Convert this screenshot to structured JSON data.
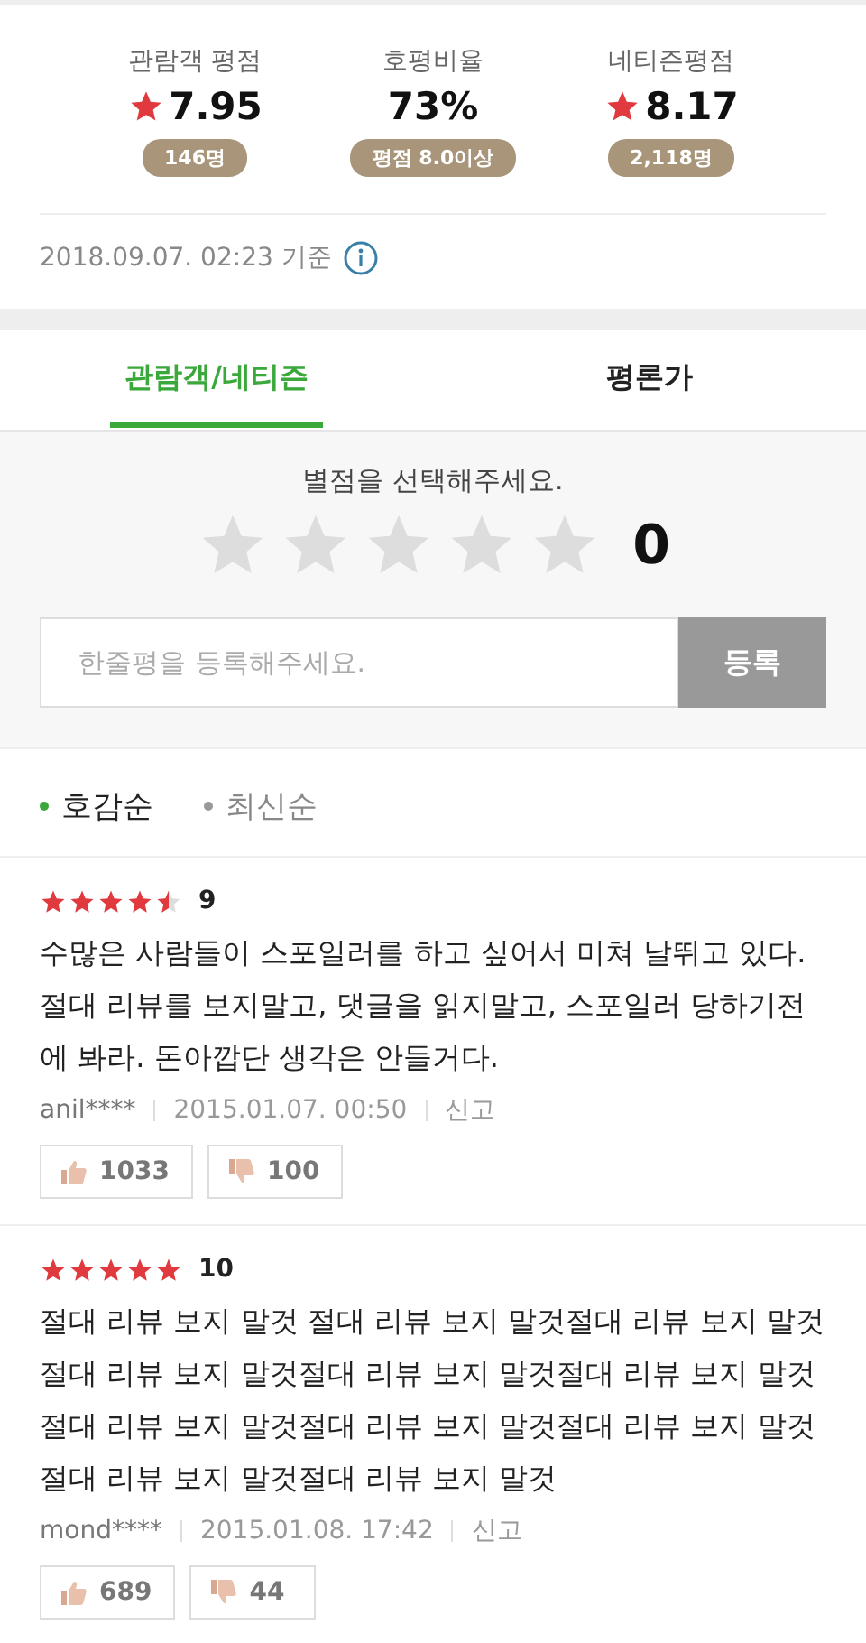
{
  "scores": [
    {
      "kind": "star",
      "label": "관람객 평점",
      "value": "7.95",
      "badge": "146명"
    },
    {
      "kind": "plain",
      "label": "호평비율",
      "value": "73%",
      "badge": "평점 8.0이상"
    },
    {
      "kind": "star",
      "label": "네티즌평점",
      "value": "8.17",
      "badge": "2,118명"
    }
  ],
  "timestamp": "2018.09.07. 02:23 기준",
  "tabs": [
    {
      "label": "관람객/네티즌",
      "selected": true
    },
    {
      "label": "평론가",
      "selected": false
    }
  ],
  "rating_input": {
    "prompt": "별점을 선택해주세요.",
    "stars": 0,
    "score": "0",
    "placeholder": "한줄평을 등록해주세요.",
    "submit": "등록"
  },
  "sort": [
    {
      "label": "호감순",
      "selected": true
    },
    {
      "label": "최신순",
      "selected": false
    }
  ],
  "reviews": [
    {
      "stars": 4.5,
      "score": "9",
      "text": "수많은 사람들이 스포일러를 하고 싶어서 미쳐 날뛰고 있다. 절대 리뷰를 보지말고, 댓글을 읽지말고, 스포일러 당하기전에 봐라. 돈아깝단 생각은 안들거다.",
      "user": "anil****",
      "date": "2015.01.07. 00:50",
      "report": "신고",
      "likes": "1033",
      "dislikes": "100"
    },
    {
      "stars": 5,
      "score": "10",
      "text": "절대 리뷰 보지 말것 절대 리뷰 보지 말것절대 리뷰 보지 말것 절대 리뷰 보지 말것절대 리뷰 보지 말것절대 리뷰 보지 말것 절대 리뷰 보지 말것절대 리뷰 보지 말것절대 리뷰 보지 말것 절대 리뷰 보지 말것절대 리뷰 보지 말것",
      "user": "mond****",
      "date": "2015.01.08. 17:42",
      "report": "신고",
      "likes": "689",
      "dislikes": "44"
    }
  ]
}
